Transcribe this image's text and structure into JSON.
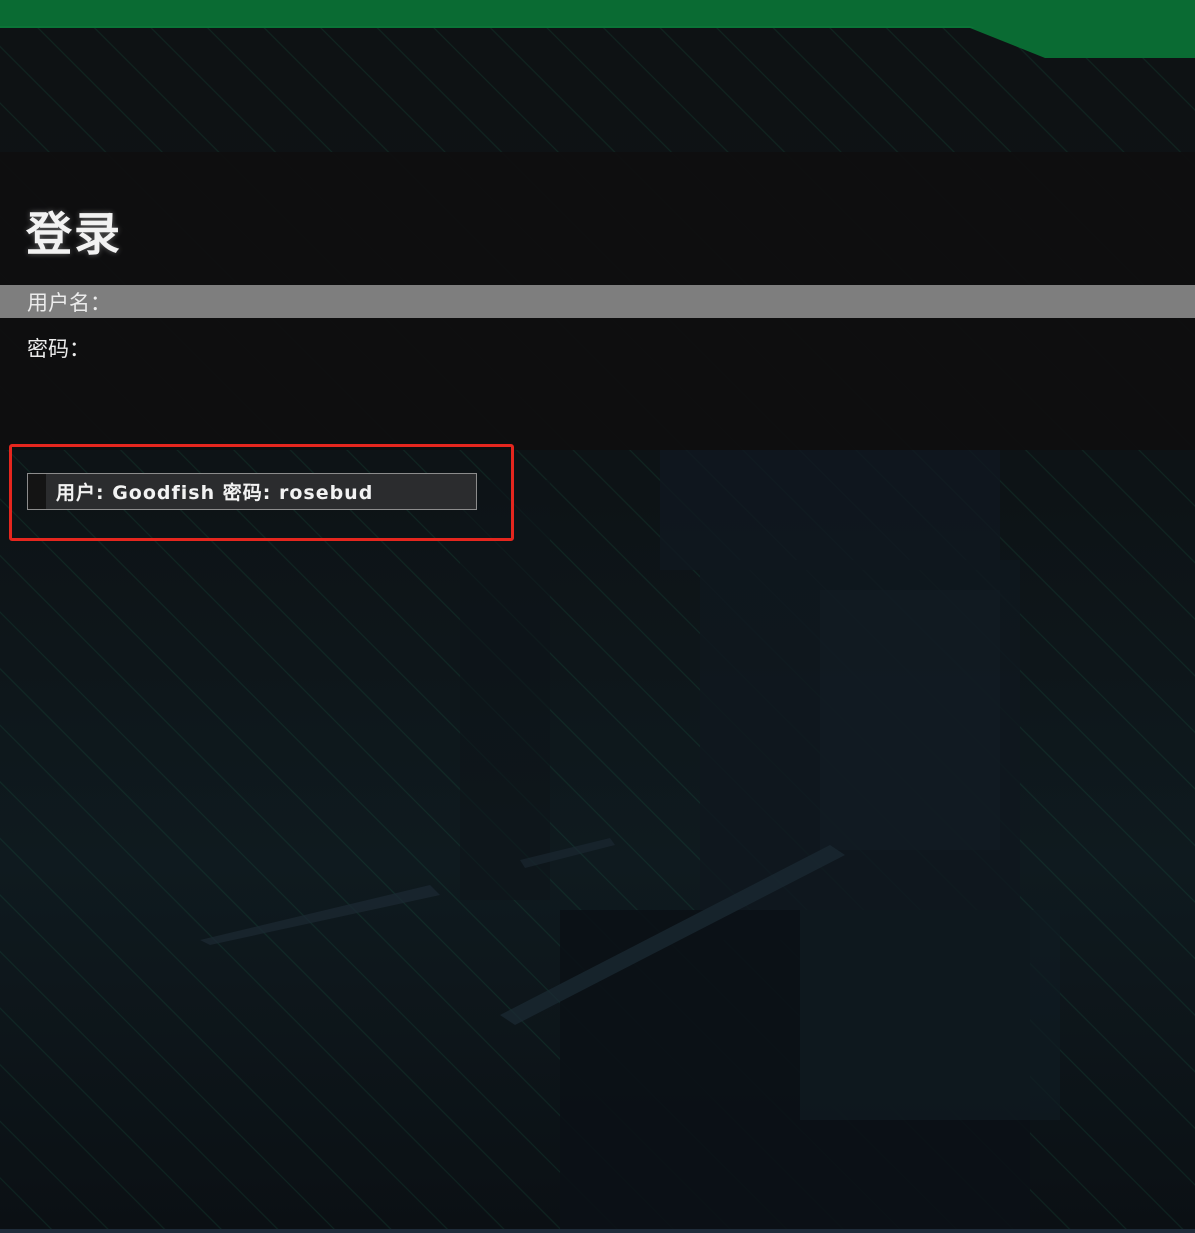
{
  "colors": {
    "accent_green": "#0a6b33",
    "highlight_red": "#e5261e",
    "selected_row": "#7e7e7e"
  },
  "login": {
    "title": "登录",
    "username_label": "用户名：",
    "username_value": "",
    "password_label": "密码：",
    "password_value": ""
  },
  "hint": {
    "text": "用户: Goodfish 密码: rosebud"
  }
}
